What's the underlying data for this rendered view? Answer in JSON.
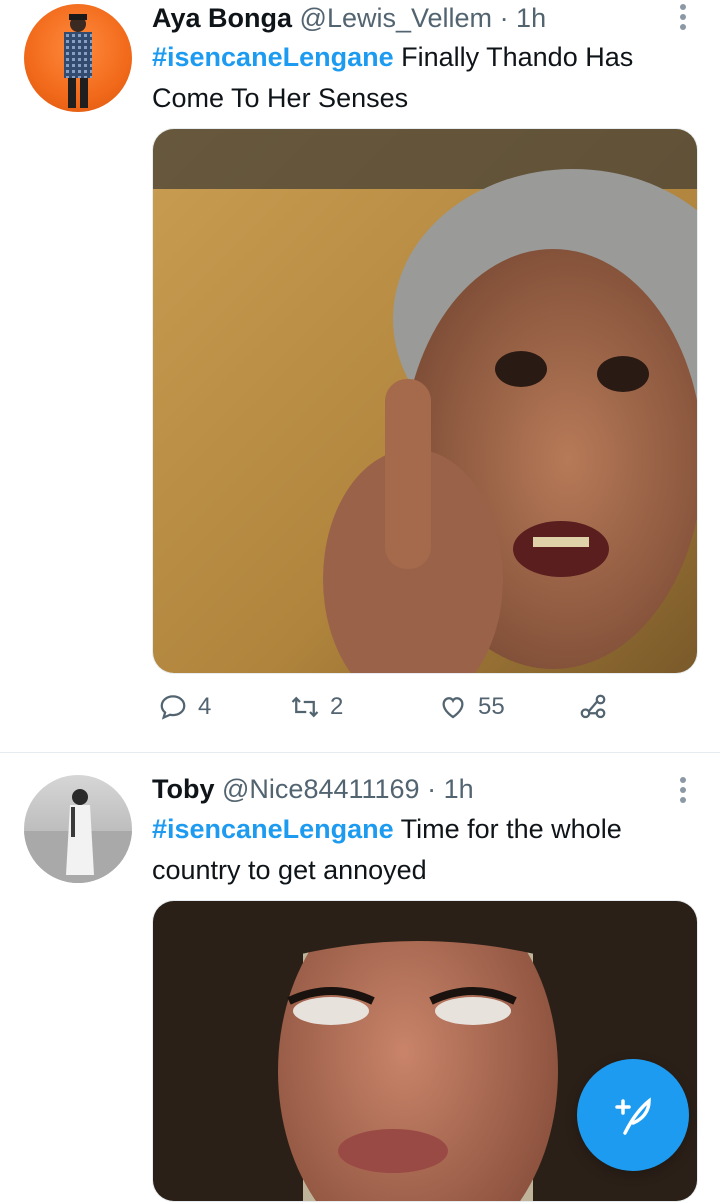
{
  "tweets": [
    {
      "display_name": "Aya Bonga",
      "handle": "@Lewis_Vellem",
      "time": "· 1h",
      "hashtag": "#isencaneLengane",
      "text": " Finally Thando Has Come To Her Senses",
      "stats": {
        "replies": "4",
        "retweets": "2",
        "likes": "55"
      }
    },
    {
      "display_name": "Toby",
      "handle": "@Nice84411169",
      "time": "· 1h",
      "hashtag": "#isencaneLengane",
      "text": " Time for the whole country to get annoyed"
    }
  ],
  "icons": {
    "reply": "reply-icon",
    "retweet": "retweet-icon",
    "like": "heart-icon",
    "share": "share-icon",
    "more": "more-vertical-icon",
    "compose": "compose-tweet-icon"
  },
  "colors": {
    "accent": "#1d9bf0",
    "secondary_text": "#536471",
    "primary_text": "#0f1419"
  }
}
